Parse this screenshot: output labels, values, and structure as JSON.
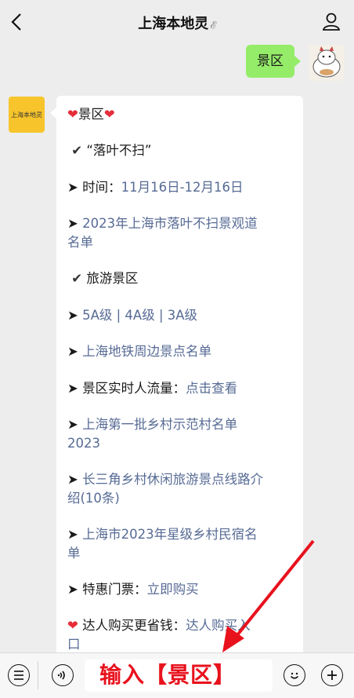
{
  "header": {
    "title": "上海本地灵",
    "ear_glyph": "ꞟ"
  },
  "me": {
    "message": "景区"
  },
  "bot": {
    "avatar_text": "上海本地灵",
    "lines": [
      {
        "heart_l": "❤",
        "text": "景区",
        "heart_r": "❤"
      },
      {
        "check": "✔",
        "text": "“落叶不扫”"
      },
      {
        "prefix": "➤ 时间：",
        "link": "11月16日-12月16日"
      },
      {
        "prefix": "➤ ",
        "link_a": "2023年上海市落叶不扫景观道",
        "link_b": "名单"
      },
      {
        "check": "✔",
        "text": "旅游景区"
      },
      {
        "prefix": "➤ ",
        "link": "5A级 | 4A级 | 3A级"
      },
      {
        "prefix": "➤ ",
        "link": "上海地铁周边景点名单"
      },
      {
        "prefix": "➤ 景区实时人流量：",
        "link": "点击查看"
      },
      {
        "prefix": "➤ ",
        "link_a": "上海第一批乡村示范村名单",
        "link_b": "2023"
      },
      {
        "prefix": "➤ ",
        "link_a": "长三角乡村休闲旅游景点线路介",
        "link_b": "绍(10条)"
      },
      {
        "prefix": "➤ ",
        "link_a": "上海市2023年星级乡村民宿名",
        "link_b": "单"
      },
      {
        "prefix": "➤ 特惠门票：",
        "link": "立即购买"
      },
      {
        "heart": "❤",
        "prefix": " 达人购买更省钱：",
        "link_a": "达人购买入",
        "link_b": "口"
      }
    ]
  },
  "overlay": {
    "text": "输入【景区】"
  },
  "colors": {
    "link": "#576b95",
    "bubble_me": "#95ec69",
    "overlay": "#e8121d"
  }
}
